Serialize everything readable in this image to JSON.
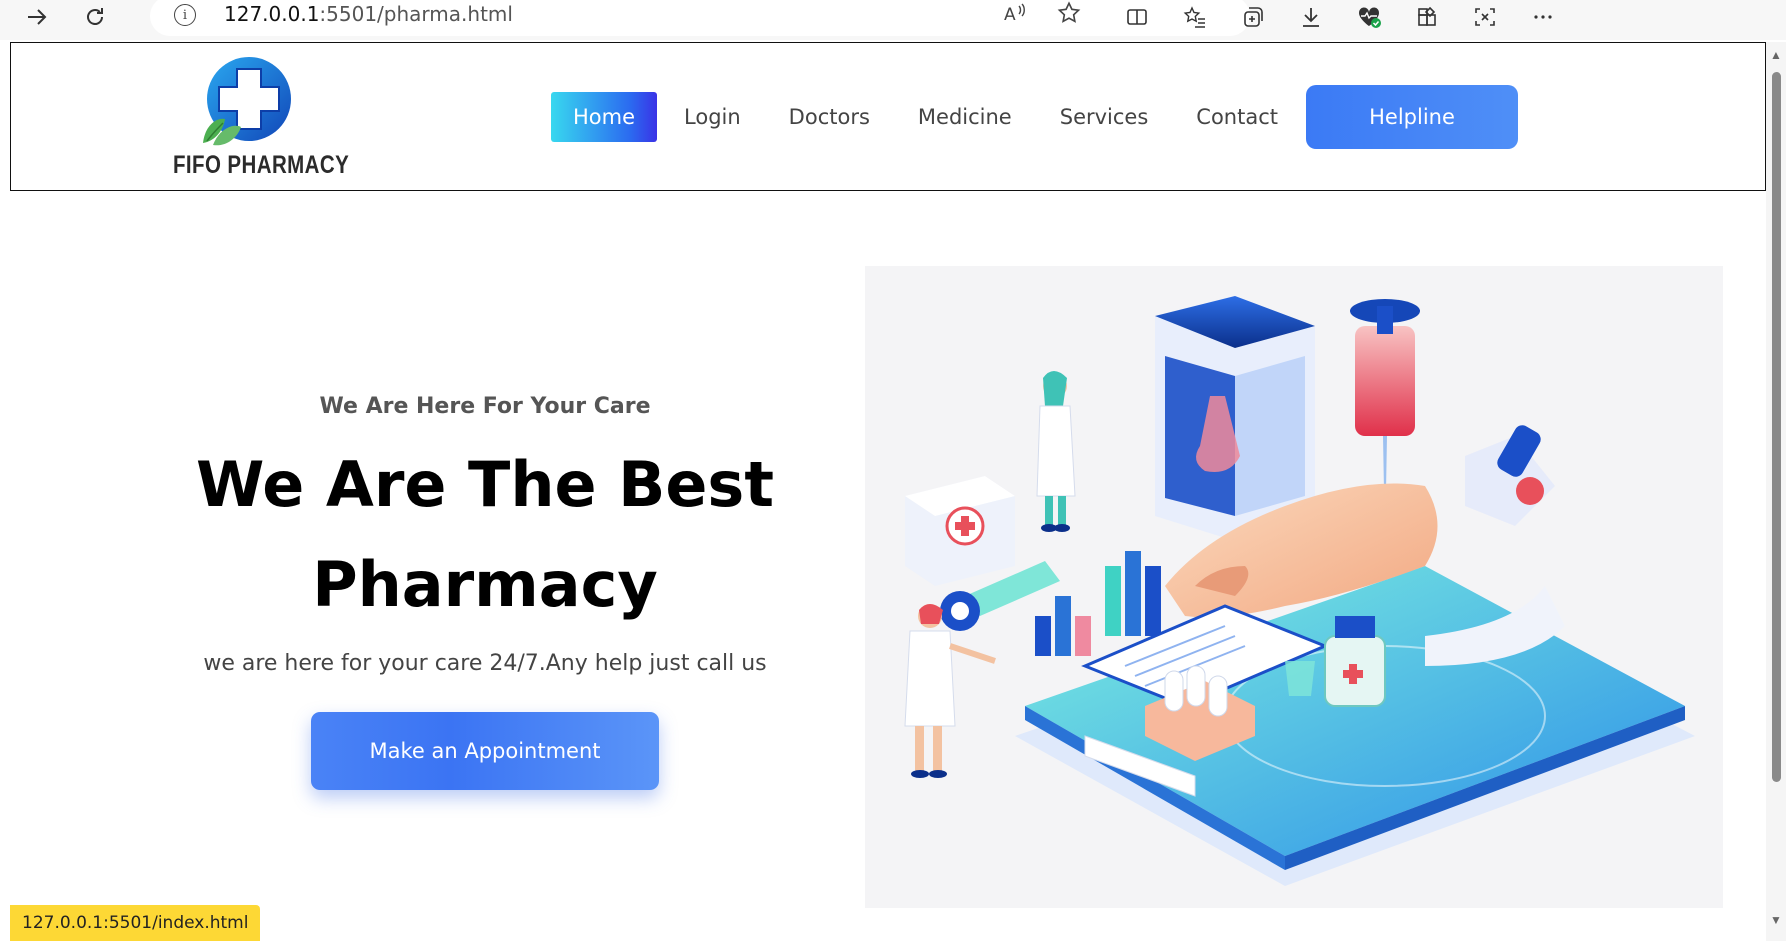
{
  "browser": {
    "url_host": "127.0.0.1",
    "url_rest": ":5501/pharma.html",
    "status_link": "127.0.0.1:5501/index.html"
  },
  "header": {
    "brand": "FIFO PHARMACY",
    "nav": [
      "Home",
      "Login",
      "Doctors",
      "Medicine",
      "Services",
      "Contact"
    ],
    "active_nav": "Home",
    "helpline_label": "Helpline"
  },
  "hero": {
    "eyebrow": "We Are Here For Your Care",
    "headline_line1": "We Are The Best",
    "headline_line2": "Pharmacy",
    "tagline": "we are here for your care 24/7.Any help just call us",
    "cta_label": "Make an Appointment"
  },
  "colors": {
    "accent": "#3b7af5",
    "nav_active_start": "#38d8ef",
    "nav_active_end": "#3a33e6",
    "status_bg": "#fdd835"
  },
  "icons": [
    "back-arrow-icon",
    "refresh-icon",
    "info-icon",
    "read-aloud-icon",
    "favorite-star-icon",
    "split-screen-icon",
    "favorites-list-icon",
    "collections-icon",
    "download-icon",
    "browser-essentials-icon",
    "extensions-icon",
    "screenshot-icon",
    "more-icon"
  ]
}
